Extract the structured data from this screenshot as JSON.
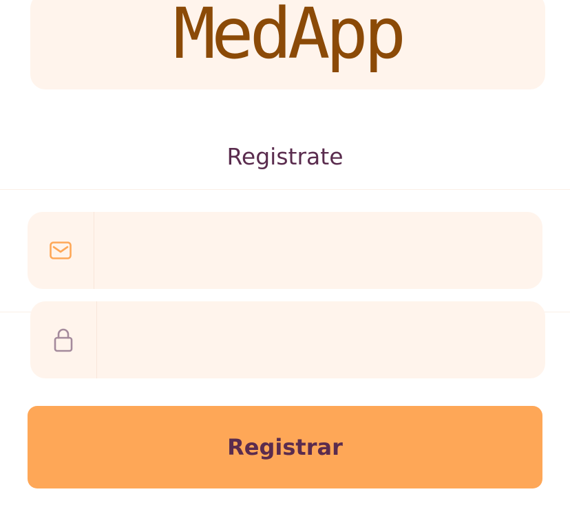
{
  "app": {
    "logo_text": "MedApp"
  },
  "form": {
    "title": "Registrate",
    "email": {
      "icon": "mail-icon",
      "value": "",
      "placeholder": ""
    },
    "password": {
      "icon": "lock-icon",
      "value": "",
      "placeholder": ""
    },
    "submit_label": "Registrar"
  },
  "colors": {
    "brand": "#8b4a07",
    "field_bg": "#fff4ec",
    "button_bg": "#fea757",
    "text": "#5a2c4e",
    "mail_icon": "#fea757",
    "lock_icon": "#a48a9c"
  }
}
